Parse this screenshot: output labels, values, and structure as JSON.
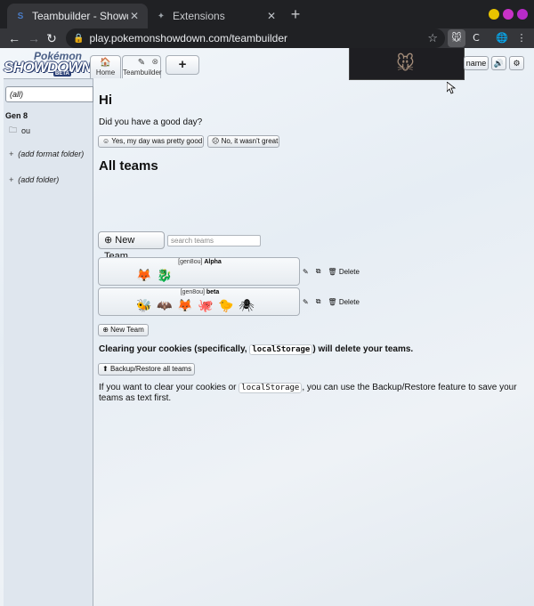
{
  "browser": {
    "tabs": [
      {
        "title": "Teambuilder - Showdown",
        "favicon": "S"
      },
      {
        "title": "Extensions",
        "favicon": "puzzle-icon"
      }
    ],
    "url": "play.pokemonshowdown.com/teambuilder",
    "window_dots": [
      "#e8c400",
      "#d23bd2",
      "#cc2dd0"
    ]
  },
  "ps": {
    "logo": {
      "line1": "Pokémon",
      "line2": "SHOWDOWN",
      "line3": "BETA"
    },
    "tabs": [
      {
        "icon": "home-icon",
        "label": "Home"
      },
      {
        "icon": "edit-icon",
        "label": "Teambuilder"
      }
    ],
    "plus": "+",
    "name_button": "name",
    "sound_icon": "🔊",
    "settings_icon": "⚙"
  },
  "sidebar": {
    "all": "(all)",
    "gen": "Gen 8",
    "folder": "ou",
    "add_format_folder": "(add format folder)",
    "add_folder": "(add folder)"
  },
  "main": {
    "greeting": "Hi",
    "question": "Did you have a good day?",
    "yes": "☺ Yes, my day was pretty good",
    "no": "☹ No, it wasn't great",
    "all_teams": "All teams",
    "new_team": "New Team",
    "search_placeholder": "search teams",
    "teams": [
      {
        "format": "[gen8ou]",
        "name": "Alpha",
        "sprites": [
          "🦊",
          "🐉"
        ]
      },
      {
        "format": "[gen8ou]",
        "name": "beta",
        "sprites": [
          "🐝",
          "🦇",
          "🦊",
          "🐙",
          "🐤",
          "🕷"
        ]
      }
    ],
    "delete_label": "Delete",
    "new_team_small": "New Team",
    "warning_pre": "Clearing your cookies (specifically, ",
    "warning_code": "localStorage",
    "warning_post": ") will delete your teams.",
    "backup": "Backup/Restore all teams",
    "info_pre": "If you want to clear your cookies or ",
    "info_code": "localStorage",
    "info_post": ", you can use the Backup/Restore feature to save your teams as text first."
  }
}
